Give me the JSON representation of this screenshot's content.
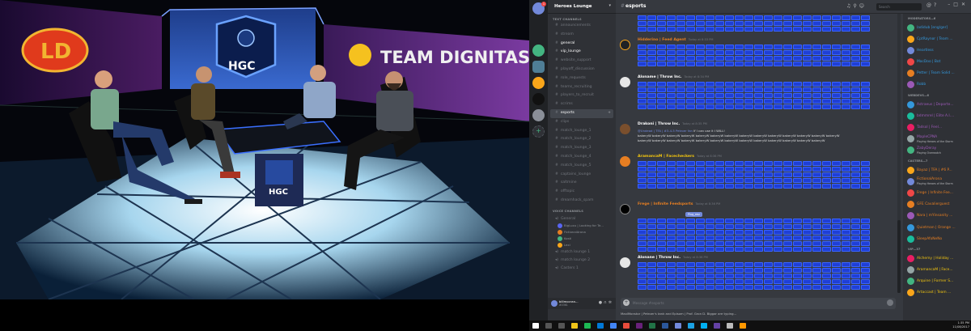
{
  "stream": {
    "backdrop_left_logo": "LD",
    "backdrop_center_logo": "HGC",
    "backdrop_right_text": "TEAM DIGNITAS",
    "desk_logo": "HGC"
  },
  "discord": {
    "server_name": "Heroes Lounge",
    "unread_badge": "1",
    "text_channels_label": "TEXT CHANNELS",
    "voice_channels_label": "VOICE CHANNELS",
    "channels": [
      {
        "name": "announcements",
        "state": "muted"
      },
      {
        "name": "stream",
        "state": "muted"
      },
      {
        "name": "general",
        "state": "unread"
      },
      {
        "name": "vip_lounge",
        "state": "unread"
      },
      {
        "name": "website_support",
        "state": "muted"
      },
      {
        "name": "playoff_discussion",
        "state": "muted"
      },
      {
        "name": "role_requests",
        "state": "muted"
      },
      {
        "name": "teams_recruiting",
        "state": "muted"
      },
      {
        "name": "players_to_recruit",
        "state": "muted"
      },
      {
        "name": "scrims",
        "state": "muted"
      },
      {
        "name": "esports",
        "state": "active"
      },
      {
        "name": "clips",
        "state": "muted"
      },
      {
        "name": "match_lounge_1",
        "state": "muted"
      },
      {
        "name": "match_lounge_2",
        "state": "muted"
      },
      {
        "name": "match_lounge_3",
        "state": "muted"
      },
      {
        "name": "match_lounge_4",
        "state": "muted"
      },
      {
        "name": "match_lounge_5",
        "state": "muted"
      },
      {
        "name": "captains_lounge",
        "state": "muted"
      },
      {
        "name": "saltmine",
        "state": "muted"
      },
      {
        "name": "offtopic",
        "state": "muted"
      },
      {
        "name": "dreamhack_spam",
        "state": "muted"
      }
    ],
    "voice": {
      "general": "General",
      "users": [
        {
          "name": "BigLuxu | Looking for Te...",
          "color": "#5865f2"
        },
        {
          "name": "FictionalArona",
          "color": "#e67e22"
        },
        {
          "name": "Kosti",
          "color": "#43b581"
        },
        {
          "name": "Lexi",
          "color": "#faa61a"
        }
      ],
      "lounge_1": "match lounge 1",
      "lounge_2": "match lounge 2",
      "casters": "Casters 1"
    },
    "user": {
      "name": "billmocran...",
      "tag": "#0361"
    },
    "chat": {
      "channel": "esports",
      "search_placeholder": "Search",
      "input_placeholder": "Message #esports",
      "tooltip": "Plug_eez",
      "typing": "MaxiMonstor | Petroer's tank and Episom | Prof. Gron D. Biggar are typing...",
      "messages": [
        {
          "author": "Hidderino | Feed Agent",
          "time": "Today at 8:33 PM",
          "color": "#e67e22",
          "emote_rows": 4
        },
        {
          "author": "Aloname | Throw Inc.",
          "time": "Today at 8:34 PM",
          "color": "#ffffff",
          "emote_rows": 5
        },
        {
          "author": "Drakoni | Throw Inc.",
          "time": "Today at 8:35 PM",
          "color": "#ffffff",
          "mention": "@Undead | TFA | #3-4-5 Petroer fan",
          "line1": " If I can use it I WILL!",
          "line2": "bakeryW bakeryW bakeryW bakeryW bakeryW bakeryW bakeryW bakeryW bakeryW bakeryW bakeryW bakeryW bakeryW bakeryW",
          "line3": "bakeryW bakeryW bakeryW bakeryW bakeryW bakeryW bakeryW bakeryW bakeryW bakeryW bakeryW bakeryW bakeryW"
        },
        {
          "author": "AramancaM | Facecheckers",
          "time": "Today at 8:36 PM",
          "color": "#f1c40f",
          "emote_rows": 5
        },
        {
          "author": "Frege | Infinite Feedsports",
          "time": "Today at 8:36 PM",
          "color": "#e67e22",
          "emote_rows": 6
        },
        {
          "author": "Alonane | Throw Inc.",
          "time": "Today at 8:36 PM",
          "color": "#ffffff",
          "emote_rows": 5
        }
      ]
    },
    "members": {
      "groups": [
        {
          "label": "MODERATORS—6",
          "users": [
            {
              "name": "ladidub [eng/ger]",
              "color": "#3498db"
            },
            {
              "name": "CptRaynor | Team ...",
              "color": "#3498db"
            },
            {
              "name": "Heartless",
              "color": "#3498db"
            },
            {
              "name": "MacDoo | Bot",
              "color": "#3498db"
            },
            {
              "name": "Petter | Team Solid ...",
              "color": "#3498db"
            },
            {
              "name": "Robb",
              "color": "#3498db"
            }
          ]
        },
        {
          "label": "WEBDEVS—6",
          "users": [
            {
              "name": "Astraeus | Deporte...",
              "color": "#9b59b6"
            },
            {
              "name": "bdmmrel | Elite A.I....",
              "color": "#9b59b6"
            },
            {
              "name": "Tadsol | Feel...",
              "color": "#9b59b6"
            },
            {
              "name": "MapleCPNA",
              "color": "#9b59b6",
              "activity": "Playing Heroes of the Storm"
            },
            {
              "name": "ZabyDeray",
              "color": "#9b59b6",
              "activity": "Playing Overwatch"
            }
          ]
        },
        {
          "label": "CASTERS—7",
          "users": [
            {
              "name": "Bayaz | TFA | #6 P...",
              "color": "#e67e22"
            },
            {
              "name": "FictionalArona",
              "color": "#e67e22",
              "activity": "Playing Heroes of the Storm"
            },
            {
              "name": "Frege | Infinite Fee...",
              "color": "#e67e22"
            },
            {
              "name": "GFE Cavalierguest",
              "color": "#e67e22"
            },
            {
              "name": "Nara | mYinsanity ...",
              "color": "#e67e22"
            },
            {
              "name": "Quietman | Orange ...",
              "color": "#e67e22"
            },
            {
              "name": "SleepAfoNeNo",
              "color": "#e67e22"
            }
          ]
        },
        {
          "label": "VIP—37",
          "users": [
            {
              "name": "Alchemy | Holiday ...",
              "color": "#f1c40f"
            },
            {
              "name": "AramancaM | Face...",
              "color": "#f1c40f"
            },
            {
              "name": "Arquine | Former S...",
              "color": "#f1c40f"
            },
            {
              "name": "Artaccast | Team ...",
              "color": "#f1c40f"
            }
          ]
        }
      ]
    }
  },
  "taskbar": {
    "time": "1:35 PM",
    "date": "11/08/2017"
  }
}
